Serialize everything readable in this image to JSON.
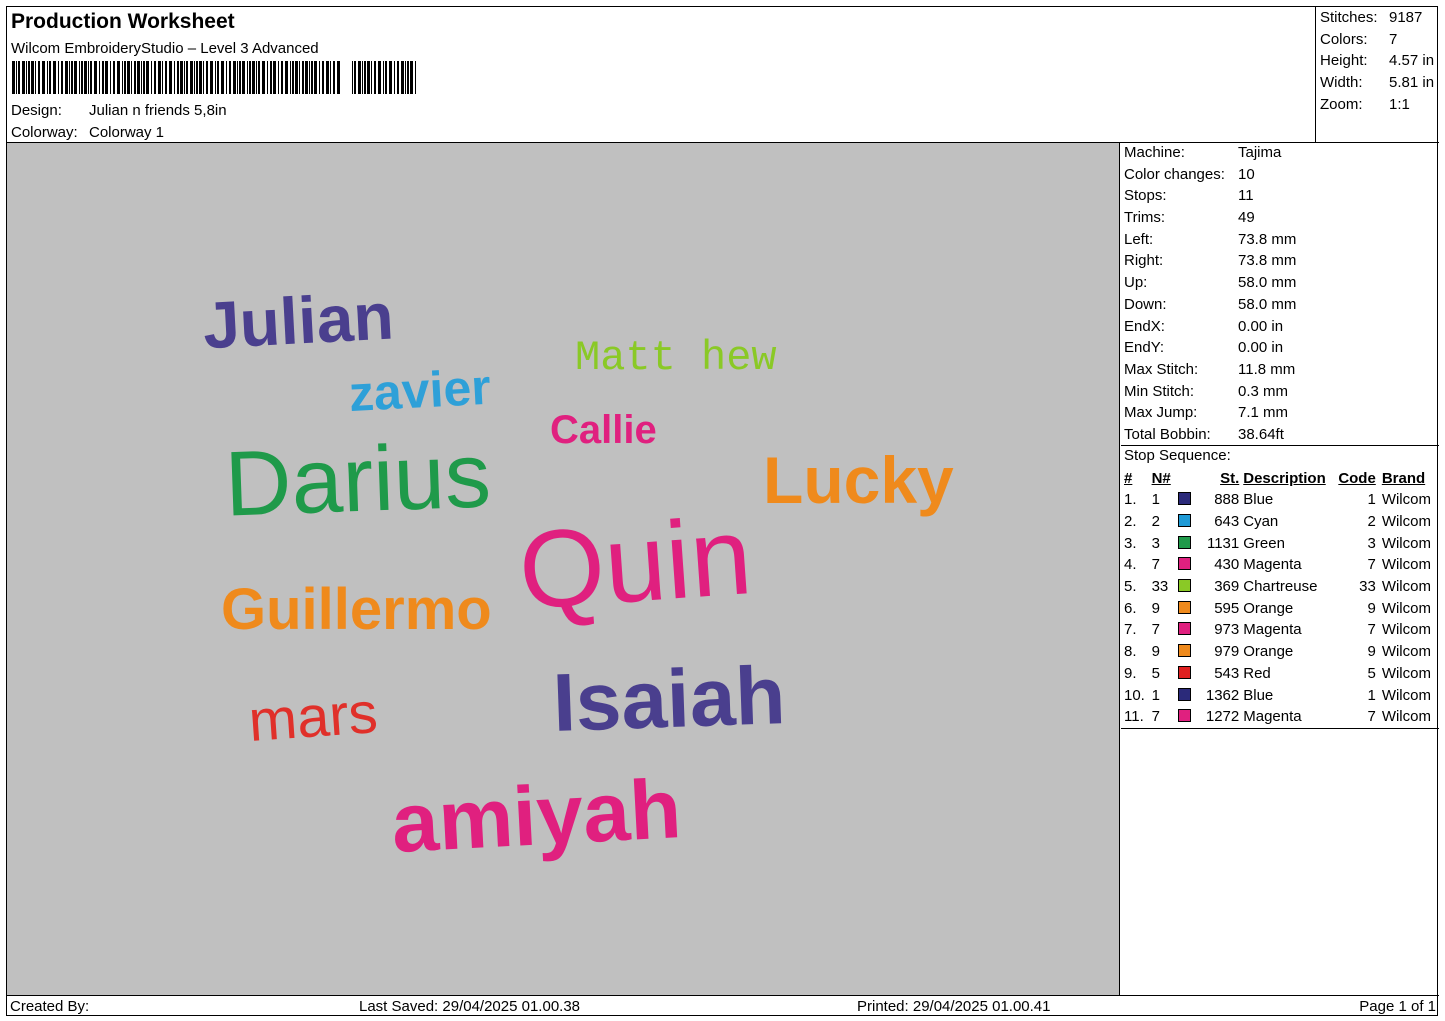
{
  "header": {
    "title": "Production Worksheet",
    "software": "Wilcom EmbroideryStudio – Level 3 Advanced",
    "design_label": "Design:",
    "design_value": "Julian n friends 5,8in",
    "colorway_label": "Colorway:",
    "colorway_value": "Colorway 1"
  },
  "stats": [
    {
      "label": "Stitches:",
      "value": "9187"
    },
    {
      "label": "Colors:",
      "value": "7"
    },
    {
      "label": "Height:",
      "value": "4.57 in"
    },
    {
      "label": "Width:",
      "value": "5.81 in"
    },
    {
      "label": "Zoom:",
      "value": "1:1"
    }
  ],
  "machine_info": [
    {
      "label": "Machine:",
      "value": "Tajima"
    },
    {
      "label": "Color changes:",
      "value": "10"
    },
    {
      "label": "Stops:",
      "value": "11"
    },
    {
      "label": "Trims:",
      "value": "49"
    },
    {
      "label": "Left:",
      "value": "73.8 mm"
    },
    {
      "label": "Right:",
      "value": "73.8 mm"
    },
    {
      "label": "Up:",
      "value": "58.0 mm"
    },
    {
      "label": "Down:",
      "value": "58.0 mm"
    },
    {
      "label": "EndX:",
      "value": "0.00 in"
    },
    {
      "label": "EndY:",
      "value": "0.00 in"
    },
    {
      "label": "Max Stitch:",
      "value": "11.8 mm"
    },
    {
      "label": "Min Stitch:",
      "value": "0.3 mm"
    },
    {
      "label": "Max Jump:",
      "value": "7.1 mm"
    },
    {
      "label": "Total Bobbin:",
      "value": "38.64ft"
    }
  ],
  "stop_sequence": {
    "title": "Stop Sequence:",
    "columns": [
      "#",
      "N#",
      "St.",
      "Description",
      "Code",
      "Brand"
    ],
    "rows": [
      {
        "idx": "1.",
        "n": "1",
        "color": "#2b2a7a",
        "st": "888",
        "desc": "Blue",
        "code": "1",
        "brand": "Wilcom"
      },
      {
        "idx": "2.",
        "n": "2",
        "color": "#1e9ad6",
        "st": "643",
        "desc": "Cyan",
        "code": "2",
        "brand": "Wilcom"
      },
      {
        "idx": "3.",
        "n": "3",
        "color": "#1f9a4a",
        "st": "1131",
        "desc": "Green",
        "code": "3",
        "brand": "Wilcom"
      },
      {
        "idx": "4.",
        "n": "7",
        "color": "#e0207f",
        "st": "430",
        "desc": "Magenta",
        "code": "7",
        "brand": "Wilcom"
      },
      {
        "idx": "5.",
        "n": "33",
        "color": "#8ac926",
        "st": "369",
        "desc": "Chartreuse",
        "code": "33",
        "brand": "Wilcom"
      },
      {
        "idx": "6.",
        "n": "9",
        "color": "#ef8a1c",
        "st": "595",
        "desc": "Orange",
        "code": "9",
        "brand": "Wilcom"
      },
      {
        "idx": "7.",
        "n": "7",
        "color": "#e0207f",
        "st": "973",
        "desc": "Magenta",
        "code": "7",
        "brand": "Wilcom"
      },
      {
        "idx": "8.",
        "n": "9",
        "color": "#ef8a1c",
        "st": "979",
        "desc": "Orange",
        "code": "9",
        "brand": "Wilcom"
      },
      {
        "idx": "9.",
        "n": "5",
        "color": "#e02020",
        "st": "543",
        "desc": "Red",
        "code": "5",
        "brand": "Wilcom"
      },
      {
        "idx": "10.",
        "n": "1",
        "color": "#2b2a7a",
        "st": "1362",
        "desc": "Blue",
        "code": "1",
        "brand": "Wilcom"
      },
      {
        "idx": "11.",
        "n": "7",
        "color": "#e0207f",
        "st": "1272",
        "desc": "Magenta",
        "code": "7",
        "brand": "Wilcom"
      }
    ]
  },
  "design_names": [
    {
      "text": "Julian",
      "color": "#4a3f8e"
    },
    {
      "text": "Matt hew",
      "color": "#8ac926"
    },
    {
      "text": "zavier",
      "color": "#2ea0d8"
    },
    {
      "text": "Callie",
      "color": "#e0207f"
    },
    {
      "text": "Darius",
      "color": "#1f9a4a"
    },
    {
      "text": "Lucky",
      "color": "#ef8a1c"
    },
    {
      "text": "Quin",
      "color": "#e0207f"
    },
    {
      "text": "Guillermo",
      "color": "#ef8a1c"
    },
    {
      "text": "mars",
      "color": "#e0302a"
    },
    {
      "text": "Isaiah",
      "color": "#4a3f8e"
    },
    {
      "text": "amiyah",
      "color": "#e0207f"
    }
  ],
  "footer": {
    "created_by": "Created By:",
    "last_saved": "Last Saved: 29/04/2025 01.00.38",
    "printed": "Printed: 29/04/2025 01.00.41",
    "page": "Page 1 of 1"
  }
}
